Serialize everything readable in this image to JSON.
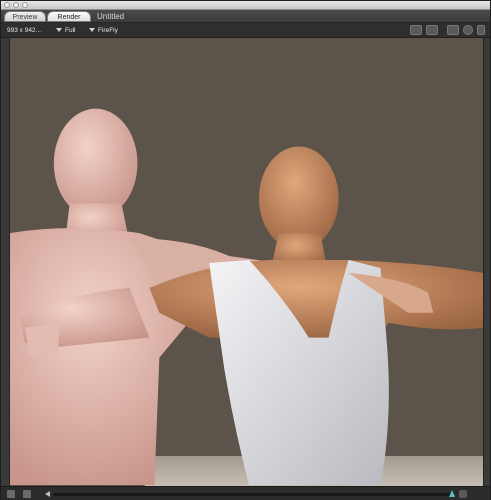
{
  "window": {
    "tabs": [
      {
        "label": "Preview",
        "active": false
      },
      {
        "label": "Render",
        "active": true
      }
    ],
    "document_title": "Untitled"
  },
  "toolbar": {
    "dimensions": "993 x 942...",
    "mode_select": "Full",
    "engine_select": "FireFly",
    "icons": [
      "render-frame-icon",
      "export-image-icon",
      "settings-icon",
      "tools-icon",
      "expand-icon"
    ]
  },
  "viewport": {
    "background_color": "#5c544b",
    "subjects": [
      "nude-male-figure",
      "male-figure-white-tank-top"
    ]
  },
  "bottombar": {
    "icons": [
      "camera-icon",
      "film-icon"
    ],
    "scrubber_position": 1.0,
    "accent": "#56c1c8"
  }
}
